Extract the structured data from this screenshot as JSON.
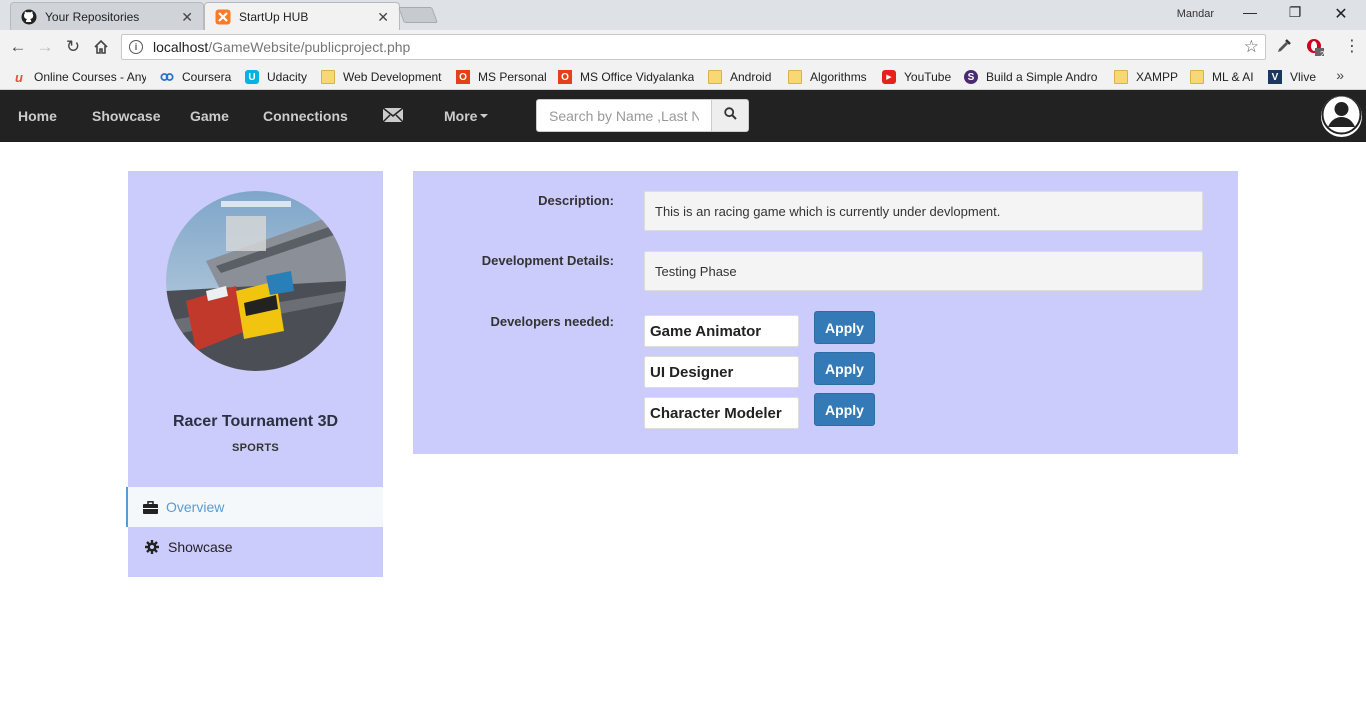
{
  "browser": {
    "tabs": [
      {
        "title": "Your Repositories",
        "icon": "github-icon",
        "active": false
      },
      {
        "title": "StartUp HUB",
        "icon": "xampp-icon",
        "active": true
      }
    ],
    "profile_name": "Mandar",
    "url_host": "localhost",
    "url_path": "/GameWebsite/publicproject.php",
    "extension_badge": "2",
    "bookmarks": [
      {
        "label": "Online Courses - Any",
        "icon": "udemy-icon"
      },
      {
        "label": "Coursera",
        "icon": "coursera-icon"
      },
      {
        "label": "Udacity",
        "icon": "udacity-icon"
      },
      {
        "label": "Web Development",
        "icon": "folder-icon"
      },
      {
        "label": "MS Personal",
        "icon": "office-icon"
      },
      {
        "label": "MS Office Vidyalanka",
        "icon": "office-icon"
      },
      {
        "label": "Android",
        "icon": "folder-icon"
      },
      {
        "label": "Algorithms",
        "icon": "folder-icon"
      },
      {
        "label": "YouTube",
        "icon": "youtube-icon"
      },
      {
        "label": "Build a Simple Andro",
        "icon": "s-icon"
      },
      {
        "label": "XAMPP",
        "icon": "folder-icon"
      },
      {
        "label": "ML & AI",
        "icon": "folder-icon"
      },
      {
        "label": "Vlive",
        "icon": "vlive-icon"
      }
    ],
    "bookmarks_more": "»"
  },
  "navbar": {
    "links": [
      "Home",
      "Showcase",
      "Game",
      "Connections"
    ],
    "mail_icon": "envelope-icon",
    "more_label": "More",
    "search_placeholder": "Search by Name ,Last Name"
  },
  "project": {
    "title": "Racer Tournament 3D",
    "category": "SPORTS",
    "menu": [
      {
        "label": "Overview",
        "icon": "briefcase-icon",
        "active": true
      },
      {
        "label": "Showcase",
        "icon": "gear-icon",
        "active": false
      }
    ]
  },
  "details": {
    "description_label": "Description:",
    "description_value": "This is an racing game which is currently under devlopment.",
    "development_label": "Development Details:",
    "development_value": "Testing Phase",
    "developers_label": "Developers needed:",
    "developers": [
      "Game Animator",
      "UI Designer",
      "Character Modeler"
    ],
    "apply_label": "Apply"
  },
  "colors": {
    "navbar_bg": "#222222",
    "panel_bg": "#ccccfc",
    "apply_btn": "#337ab7",
    "active_menu": "#5b9bd1"
  }
}
